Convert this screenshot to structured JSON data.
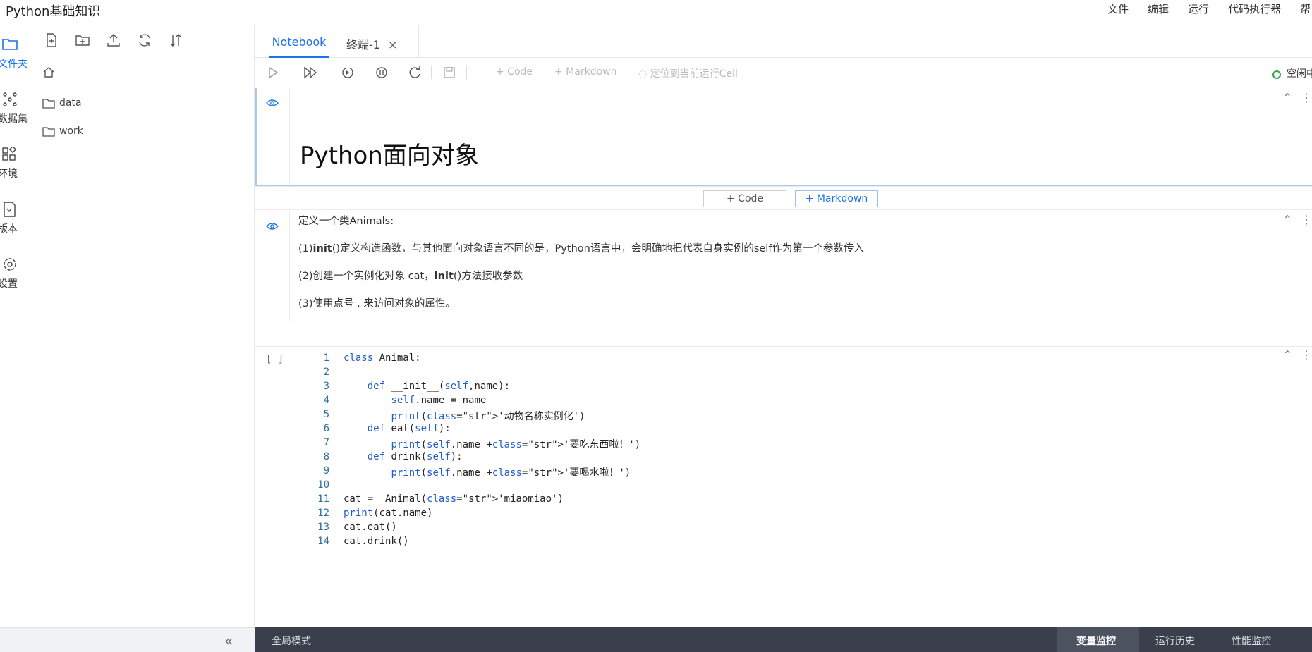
{
  "app": {
    "title": "Python基础知识"
  },
  "menu": [
    "文件",
    "编辑",
    "运行",
    "代码执行器",
    "帮"
  ],
  "rail": [
    {
      "label": "文件夹",
      "icon": "folder-icon"
    },
    {
      "label": "数据集",
      "icon": "dataset-icon"
    },
    {
      "label": "环境",
      "icon": "environment-icon"
    },
    {
      "label": "版本",
      "icon": "version-icon"
    },
    {
      "label": "设置",
      "icon": "settings-icon"
    }
  ],
  "files": [
    {
      "name": "data",
      "icon": "folder-icon"
    },
    {
      "name": "work",
      "icon": "folder-icon"
    }
  ],
  "tabs": [
    {
      "label": "Notebook"
    },
    {
      "label": "终端-1",
      "close": "×"
    }
  ],
  "toolbar": {
    "add_code": "+ Code",
    "add_markdown": "+ Markdown",
    "locate": "定位到当前运行Cell",
    "kernel_status": "空闲中"
  },
  "cells": {
    "heading": "Python面向对象",
    "add_code": "+ Code",
    "add_markdown": "+ Markdown",
    "md_lines": [
      {
        "plain": "定义一个类Animals:"
      },
      {
        "pre": "(1)",
        "bold": "init",
        "post": "()定义构造函数，与其他面向对象语言不同的是，Python语言中，会明确地把代表自身实例的self作为第一个参数传入"
      },
      {
        "pre": "(2)创建一个实例化对象 cat，",
        "bold": "init",
        "post": "()方法接收参数"
      },
      {
        "plain": "(3)使用点号 . 来访问对象的属性。"
      }
    ],
    "prompt": "[ ]",
    "code_lines": [
      "class Animal:",
      "",
      "    def __init__(self,name):",
      "        self.name = name",
      "        print('动物名称实例化')",
      "    def eat(self):",
      "        print(self.name +'要吃东西啦！')",
      "    def drink(self):",
      "        print(self.name +'要喝水啦！')",
      "",
      "cat =  Animal('miaomiao')",
      "print(cat.name)",
      "cat.eat()",
      "cat.drink()"
    ]
  },
  "statusbar": {
    "mode": "全局模式",
    "variable_monitor": "变量监控",
    "run_history": "运行历史",
    "performance_monitor": "性能监控"
  },
  "colors": {
    "accent": "#1a73e8",
    "kernel_idle": "#2aa84a",
    "statusbar_bg": "#3a3f4b"
  }
}
